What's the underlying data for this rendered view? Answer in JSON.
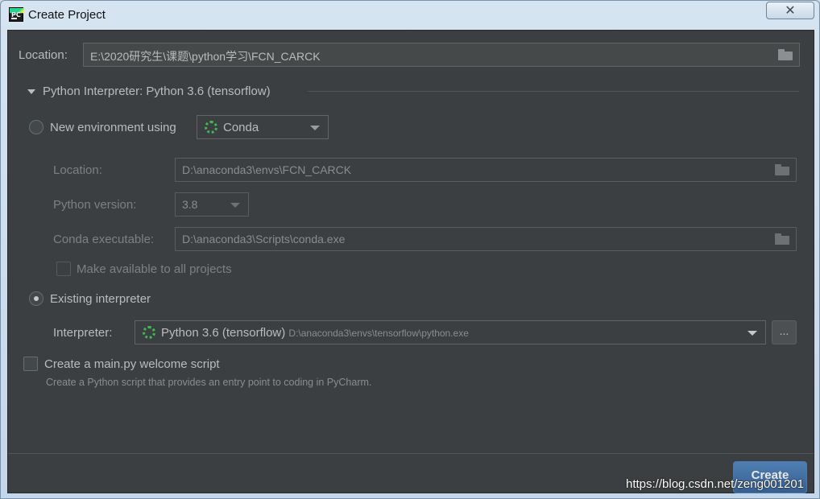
{
  "window": {
    "title": "Create Project",
    "close_label": "✕"
  },
  "location": {
    "label": "Location:",
    "value": "E:\\2020研究生\\课题\\python学习\\FCN_CARCK"
  },
  "interpreter_section": {
    "title": "Python Interpreter: Python 3.6 (tensorflow)"
  },
  "new_env": {
    "label": "New environment using",
    "tool": "Conda",
    "location_label": "Location:",
    "location_value": "D:\\anaconda3\\envs\\FCN_CARCK",
    "python_version_label": "Python version:",
    "python_version_value": "3.8",
    "conda_exe_label": "Conda executable:",
    "conda_exe_value": "D:\\anaconda3\\Scripts\\conda.exe",
    "make_available_label": "Make available to all projects"
  },
  "existing": {
    "label": "Existing interpreter",
    "interpreter_label": "Interpreter:",
    "interpreter_name": "Python 3.6 (tensorflow)",
    "interpreter_path": "D:\\anaconda3\\envs\\tensorflow\\python.exe",
    "browse_label": "..."
  },
  "welcome_script": {
    "label": "Create a main.py welcome script",
    "hint": "Create a Python script that provides an entry point to coding in PyCharm."
  },
  "footer": {
    "create_label": "Create"
  },
  "watermark": "https://blog.csdn.net/zeng001201",
  "colors": {
    "background": "#3c3f41",
    "accent": "#365f8f",
    "conda": "#3fb950"
  }
}
